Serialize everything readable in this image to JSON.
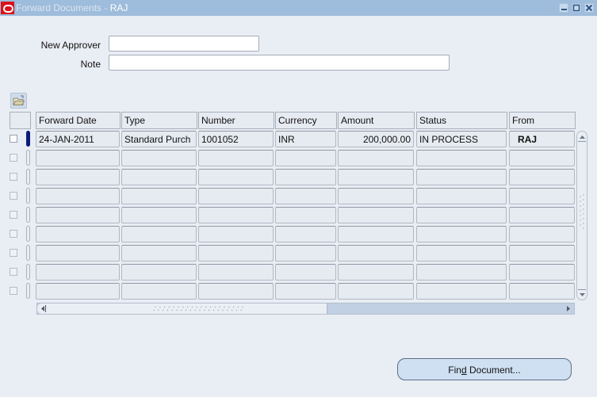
{
  "window": {
    "title": "Forward Documents - ",
    "title_user": "RAJ",
    "controls": [
      "minimize-icon",
      "maximize-icon",
      "close-icon"
    ]
  },
  "form": {
    "new_approver": {
      "label": "New Approver",
      "value": "",
      "placeholder": ""
    },
    "note": {
      "label": "Note",
      "value": "",
      "placeholder": ""
    }
  },
  "toolbar": {
    "folder_icon": "folder-open-icon"
  },
  "table": {
    "columns": [
      "Forward Date",
      "Type",
      "Number",
      "Currency",
      "Amount",
      "Status",
      "From"
    ],
    "rows": [
      {
        "forward_date": "24-JAN-2011",
        "type": "Standard Purch",
        "number": "1001052",
        "currency": "INR",
        "amount": "200,000.00",
        "status": "IN PROCESS",
        "from": "RAJ",
        "selected": true
      },
      {
        "forward_date": "",
        "type": "",
        "number": "",
        "currency": "",
        "amount": "",
        "status": "",
        "from": ""
      },
      {
        "forward_date": "",
        "type": "",
        "number": "",
        "currency": "",
        "amount": "",
        "status": "",
        "from": ""
      },
      {
        "forward_date": "",
        "type": "",
        "number": "",
        "currency": "",
        "amount": "",
        "status": "",
        "from": ""
      },
      {
        "forward_date": "",
        "type": "",
        "number": "",
        "currency": "",
        "amount": "",
        "status": "",
        "from": ""
      },
      {
        "forward_date": "",
        "type": "",
        "number": "",
        "currency": "",
        "amount": "",
        "status": "",
        "from": ""
      },
      {
        "forward_date": "",
        "type": "",
        "number": "",
        "currency": "",
        "amount": "",
        "status": "",
        "from": ""
      },
      {
        "forward_date": "",
        "type": "",
        "number": "",
        "currency": "",
        "amount": "",
        "status": "",
        "from": ""
      },
      {
        "forward_date": "",
        "type": "",
        "number": "",
        "currency": "",
        "amount": "",
        "status": "",
        "from": ""
      }
    ]
  },
  "buttons": {
    "find_document": {
      "prefix": "Fin",
      "mnemonic": "d",
      "suffix": " Document..."
    }
  },
  "colors": {
    "titlebar": "#9ebcdb",
    "background": "#e9edf4",
    "selection_marker": "#0b1b7a",
    "oracle_red": "#d8141c"
  }
}
